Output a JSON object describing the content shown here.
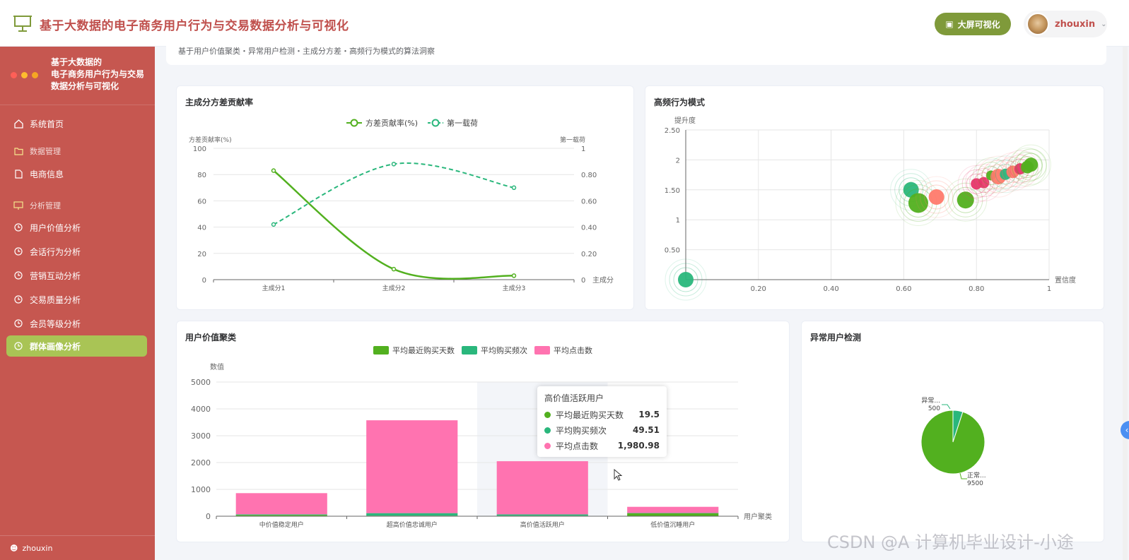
{
  "header": {
    "title": "基于大数据的电子商务用户行为与交易数据分析与可视化",
    "bigscreen_label": "大屏可视化",
    "username": "zhouxin",
    "accent": "#c0504d"
  },
  "sidebar": {
    "brand_lines": [
      "基于大数据的",
      "电子商务用户行为与交易",
      "数据分析与可视化"
    ],
    "items": [
      {
        "label": "系统首页",
        "icon": "home-icon"
      },
      {
        "label": "数据管理",
        "icon": "folder-icon",
        "group": true
      },
      {
        "label": "电商信息",
        "icon": "document-icon"
      },
      {
        "label": "分析管理",
        "icon": "chart-board-icon",
        "group": true
      },
      {
        "label": "用户价值分析",
        "icon": "clock-icon"
      },
      {
        "label": "会话行为分析",
        "icon": "clock-icon"
      },
      {
        "label": "营销互动分析",
        "icon": "clock-icon"
      },
      {
        "label": "交易质量分析",
        "icon": "clock-icon"
      },
      {
        "label": "会员等级分析",
        "icon": "clock-icon"
      },
      {
        "label": "群体画像分析",
        "icon": "clock-icon",
        "active": true
      }
    ],
    "footer_user": "zhouxin",
    "bg": "#c65750",
    "active_bg": "#a9c455"
  },
  "breadcrumb": "基于用户价值聚类・异常用户检测・主成分方差・高频行为模式的算法洞察",
  "panels": {
    "pca_title": "主成分方差贡献率",
    "freq_title": "高频行为模式",
    "cluster_title": "用户价值聚类",
    "anomaly_title": "异常用户检测"
  },
  "tooltip": {
    "title": "高价值活跃用户",
    "rows": [
      {
        "name": "平均最近购买天数",
        "value": "19.5",
        "color": "#52b01f"
      },
      {
        "name": "平均购买频次",
        "value": "49.51",
        "color": "#2ab77c"
      },
      {
        "name": "平均点击数",
        "value": "1,980.98",
        "color": "#ff73b0"
      }
    ]
  },
  "watermark": "CSDN @A 计算机毕业设计-小途",
  "chart_data": [
    {
      "type": "line",
      "title": "主成分方差贡献率",
      "categories": [
        "主成分1",
        "主成分2",
        "主成分3"
      ],
      "xlabel": "主成分",
      "ylabel": "方差贡献率(%)",
      "y2label": "第一载荷",
      "ylim": [
        0,
        100
      ],
      "y2lim": [
        0,
        1
      ],
      "y_ticks": [
        "0",
        "20",
        "40",
        "60",
        "80",
        "100"
      ],
      "y2_ticks": [
        "0",
        "0.20",
        "0.40",
        "0.60",
        "0.80",
        "1"
      ],
      "series": [
        {
          "name": "方差贡献率(%)",
          "values": [
            83,
            8,
            3
          ],
          "axis": "left",
          "color": "#52b01f",
          "style": "solid"
        },
        {
          "name": "第一载荷",
          "values": [
            0.42,
            0.88,
            0.7
          ],
          "axis": "right",
          "color": "#2ab77c",
          "style": "dashed"
        }
      ],
      "legend": "top-center"
    },
    {
      "type": "scatter",
      "title": "高频行为模式",
      "xlabel": "置信度",
      "ylabel": "提升度",
      "xlim": [
        0,
        1
      ],
      "ylim": [
        0,
        2.5
      ],
      "x_ticks": [
        "0.20",
        "0.40",
        "0.60",
        "0.80",
        "1"
      ],
      "y_ticks": [
        "0.50",
        "1",
        "1.50",
        "2",
        "2.50"
      ],
      "points": [
        {
          "x": 0.0,
          "y": 0.0,
          "size": 11,
          "color": "#2ab77c"
        },
        {
          "x": 0.62,
          "y": 1.5,
          "size": 11,
          "color": "#2ab77c"
        },
        {
          "x": 0.64,
          "y": 1.28,
          "size": 14,
          "color": "#52b01f"
        },
        {
          "x": 0.69,
          "y": 1.38,
          "size": 11,
          "color": "#ff7a6b"
        },
        {
          "x": 0.77,
          "y": 1.33,
          "size": 12,
          "color": "#52b01f"
        },
        {
          "x": 0.8,
          "y": 1.6,
          "size": 8,
          "color": "#e8356b"
        },
        {
          "x": 0.82,
          "y": 1.62,
          "size": 8,
          "color": "#e8356b"
        },
        {
          "x": 0.84,
          "y": 1.74,
          "size": 7,
          "color": "#52b01f"
        },
        {
          "x": 0.86,
          "y": 1.72,
          "size": 11,
          "color": "#ff7a6b"
        },
        {
          "x": 0.88,
          "y": 1.76,
          "size": 8,
          "color": "#2ab77c"
        },
        {
          "x": 0.9,
          "y": 1.8,
          "size": 9,
          "color": "#ff7a6b"
        },
        {
          "x": 0.92,
          "y": 1.85,
          "size": 8,
          "color": "#e8356b"
        },
        {
          "x": 0.94,
          "y": 1.88,
          "size": 9,
          "color": "#52b01f"
        },
        {
          "x": 0.95,
          "y": 1.92,
          "size": 10,
          "color": "#52b01f"
        }
      ]
    },
    {
      "type": "bar",
      "title": "用户价值聚类",
      "categories": [
        "中价值稳定用户",
        "超高价值忠诚用户",
        "高价值活跃用户",
        "低价值沉睡用户"
      ],
      "xlabel": "用户聚类",
      "ylabel": "数值",
      "ylim": [
        0,
        5000
      ],
      "y_ticks": [
        "0",
        "1000",
        "2000",
        "3000",
        "4000",
        "5000"
      ],
      "stacked": true,
      "series": [
        {
          "name": "平均最近购买天数",
          "values": [
            45,
            20,
            19.5,
            110
          ],
          "color": "#52b01f"
        },
        {
          "name": "平均购买频次",
          "values": [
            25,
            95,
            49.51,
            10
          ],
          "color": "#2ab77c"
        },
        {
          "name": "平均点击数",
          "values": [
            790,
            3460,
            1980.98,
            230
          ],
          "color": "#ff73b0"
        }
      ],
      "legend": "top-center"
    },
    {
      "type": "pie",
      "title": "异常用户检测",
      "labels": [
        "异常...",
        "正常..."
      ],
      "values": [
        500,
        9500
      ],
      "colors": [
        "#2ab77c",
        "#52b01f"
      ]
    }
  ]
}
